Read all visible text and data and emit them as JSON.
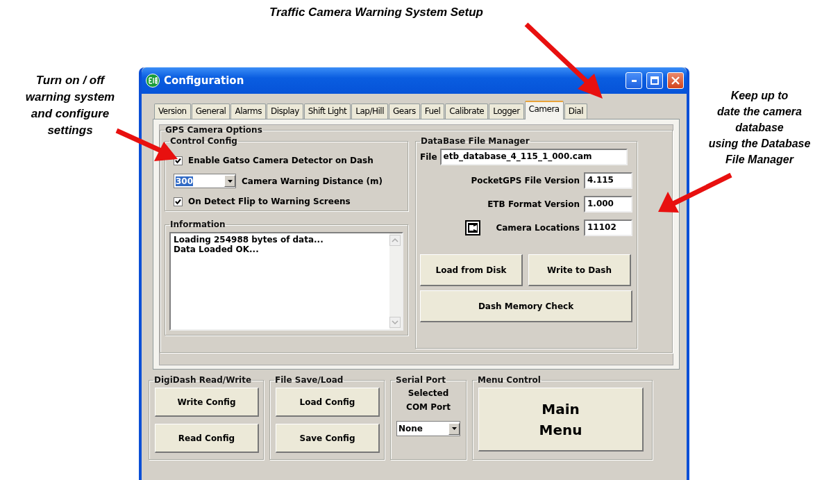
{
  "annotations": [
    {
      "kind": "top",
      "lines": [
        "Traffic Camera Warning System Setup"
      ]
    },
    {
      "kind": "left",
      "lines": [
        "Turn on / off",
        "warning system",
        "and configure",
        "settings"
      ]
    },
    {
      "kind": "right",
      "lines": [
        "Keep up to",
        "date the camera",
        "database",
        "using the Database",
        "File Manager"
      ]
    }
  ],
  "window": {
    "title": "Configuration",
    "tabs": [
      {
        "label": "Version",
        "selected": false
      },
      {
        "label": "General",
        "selected": false
      },
      {
        "label": "Alarms",
        "selected": false
      },
      {
        "label": "Display",
        "selected": false
      },
      {
        "label": "Shift Light",
        "selected": false
      },
      {
        "label": "Lap/Hill",
        "selected": false
      },
      {
        "label": "Gears",
        "selected": false
      },
      {
        "label": "Fuel",
        "selected": false
      },
      {
        "label": "Calibrate",
        "selected": false
      },
      {
        "label": "Logger",
        "selected": false
      },
      {
        "label": "Camera",
        "selected": true
      },
      {
        "label": "Dial",
        "selected": false
      }
    ],
    "gps_camera_options": {
      "title": "GPS Camera Options",
      "control_config": {
        "title": "Control Config",
        "items": [
          {
            "kind": "checkbox",
            "label": "Enable Gatso Camera Detector on Dash",
            "checked": true
          },
          {
            "kind": "combo",
            "dropdown": {
              "value": "300"
            },
            "label": "Camera Warning Distance (m)"
          },
          {
            "kind": "checkbox",
            "label": "On Detect Flip to Warning Screens",
            "checked": true
          }
        ]
      },
      "information": {
        "title": "Information",
        "lines": [
          "Loading 254988 bytes of data...",
          "Data Loaded OK..."
        ]
      },
      "database": {
        "title": "DataBase File Manager",
        "file_label": "File",
        "file_value": "etb_database_4_115_1_000.cam",
        "fields": [
          {
            "label": "PocketGPS File Version",
            "value": "4.115"
          },
          {
            "label": "ETB Format Version",
            "value": "1.000"
          },
          {
            "label": "Camera Locations",
            "value": "11102",
            "icon": true
          }
        ],
        "buttons": [
          "Load from Disk",
          "Write to Dash"
        ],
        "wide_button": "Dash Memory Check"
      }
    },
    "bottom_groups": [
      {
        "kind": "buttons",
        "title": "DigiDash Read/Write",
        "buttons": [
          "Write Config",
          "Read Config"
        ]
      },
      {
        "kind": "buttons",
        "title": "File Save/Load",
        "buttons": [
          "Load Config",
          "Save Config"
        ]
      },
      {
        "kind": "port",
        "title": "Serial Port",
        "lines": [
          "Selected",
          "COM Port"
        ],
        "value": "None"
      },
      {
        "kind": "menu",
        "title": "Menu Control",
        "lines": [
          "Main",
          "Menu"
        ]
      }
    ]
  }
}
